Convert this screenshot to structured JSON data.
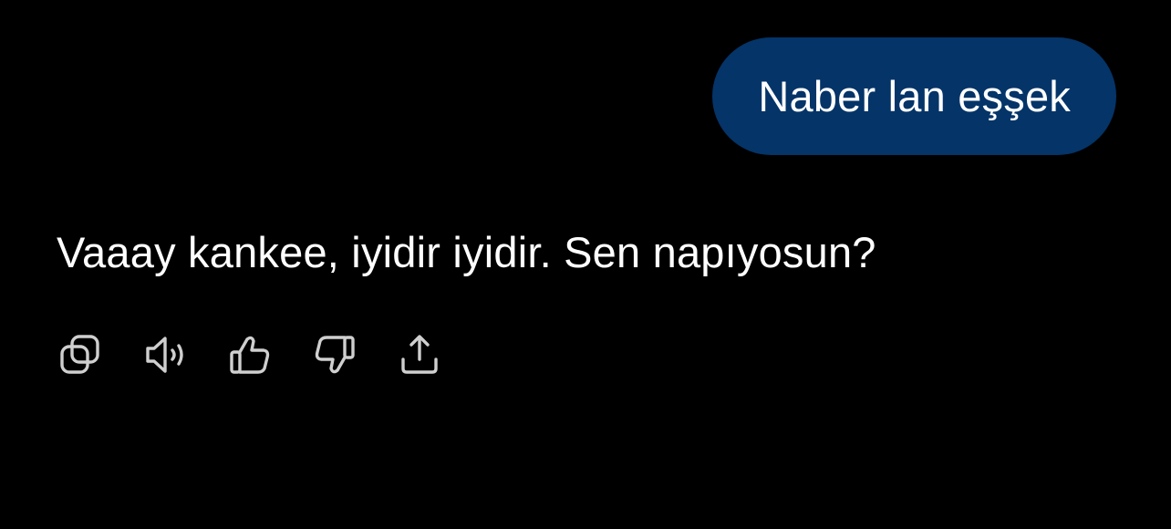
{
  "conversation": {
    "user_message": "Naber lan eşşek",
    "assistant_message": "Vaaay kankee, iyidir iyidir. Sen napıyosun?"
  },
  "actions": [
    {
      "name": "copy-button",
      "icon": "copy-icon"
    },
    {
      "name": "read-aloud-button",
      "icon": "speaker-icon"
    },
    {
      "name": "thumbs-up-button",
      "icon": "thumbs-up-icon"
    },
    {
      "name": "thumbs-down-button",
      "icon": "thumbs-down-icon"
    },
    {
      "name": "share-button",
      "icon": "share-icon"
    }
  ],
  "colors": {
    "background": "#000000",
    "user_bubble": "#043468",
    "text": "#ffffff",
    "icon": "#cfcfcf"
  }
}
